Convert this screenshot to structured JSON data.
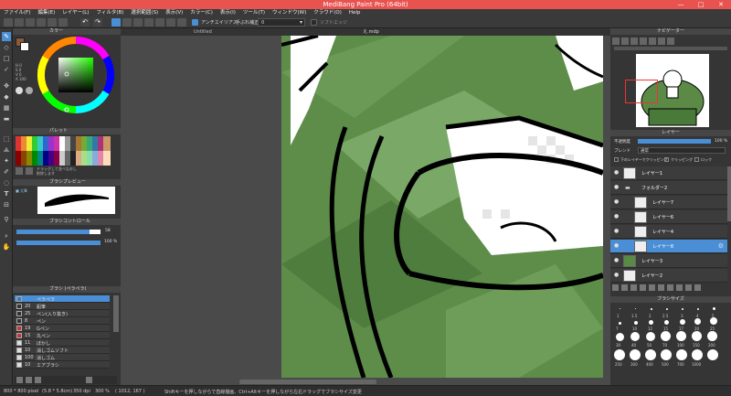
{
  "app": {
    "title": "MediBang Paint Pro (64bit)",
    "window_controls": [
      "—",
      "□",
      "✕"
    ]
  },
  "menu": [
    "ファイル(F)",
    "編集(E)",
    "レイヤー(L)",
    "フィルタ(B)",
    "選択範囲(S)",
    "表示(V)",
    "カラー(C)",
    "表示(I)",
    "ツール(T)",
    "ウィンドウ(W)",
    "クラウド(O)",
    "Help"
  ],
  "toolbar": {
    "antialias_label": "アンチエイリアス",
    "correction_label": "手ぶれ補正",
    "correction_value": "0",
    "soft_edge_label": "ソフトエッジ"
  },
  "canvas": {
    "tabs": [
      "Untitled",
      "え.mdp"
    ]
  },
  "colorpanel": {
    "title": "カラー",
    "hsv_values": [
      "H 0",
      "S 0",
      "V 0",
      "A 100"
    ]
  },
  "palette": {
    "title": "パレット",
    "note": "ドラッグして並べなおし\n削除します"
  },
  "brushpreview": {
    "title": "ブラシプレビュー",
    "label": "■ 太筆"
  },
  "brushcontrol": {
    "title": "ブラシコントロール",
    "size_value": "58",
    "opacity_value": "100 %"
  },
  "brushlist": {
    "title": "ブラシ (ペラペラ)",
    "items": [
      {
        "num": "",
        "name": "ペラペラ",
        "color": "#3a78c0"
      },
      {
        "num": "20",
        "name": "鉛筆",
        "color": "#333333"
      },
      {
        "num": "25",
        "name": "ペン(入り抜き)",
        "color": "#333333"
      },
      {
        "num": "8",
        "name": "ペン",
        "color": "#333333"
      },
      {
        "num": "19",
        "name": "Gペン",
        "color": "#cc3333"
      },
      {
        "num": "15",
        "name": "丸ペン",
        "color": "#cc3333"
      },
      {
        "num": "11",
        "name": "ぼかし",
        "color": "#dddddd"
      },
      {
        "num": "10",
        "name": "消しゴムソフト",
        "color": "#dddddd"
      },
      {
        "num": "100",
        "name": "消しゴム",
        "color": "#dddddd"
      },
      {
        "num": "10",
        "name": "エアブラシ",
        "color": "#dddddd"
      }
    ]
  },
  "navigator": {
    "title": "ナビゲーター"
  },
  "layers": {
    "title": "レイヤー",
    "opacity_label": "不透明度",
    "opacity_value": "100 %",
    "blend_label": "ブレンド",
    "blend_value": "通常",
    "checks": [
      "下のレイヤーでクリッピング",
      "クリッピング",
      "ロック"
    ],
    "items": [
      {
        "name": "レイヤー1",
        "indent": 0,
        "selected": false
      },
      {
        "name": "フォルダー2",
        "indent": 0,
        "selected": false
      },
      {
        "name": "レイヤー7",
        "indent": 1,
        "selected": false
      },
      {
        "name": "レイヤー6",
        "indent": 1,
        "selected": false
      },
      {
        "name": "レイヤー4",
        "indent": 1,
        "selected": false
      },
      {
        "name": "レイヤー8",
        "indent": 1,
        "selected": true
      },
      {
        "name": "レイヤー3",
        "indent": 0,
        "selected": false
      },
      {
        "name": "レイヤー2",
        "indent": 0,
        "selected": false
      }
    ]
  },
  "brushsize": {
    "title": "ブラシサイズ",
    "sizes": [
      "1",
      "1.5",
      "2",
      "2.5",
      "3",
      "4",
      "5",
      "7",
      "10",
      "12",
      "15",
      "17",
      "20",
      "25",
      "30",
      "40",
      "50",
      "70",
      "100",
      "150",
      "200",
      "250",
      "300",
      "400",
      "500",
      "700",
      "1000"
    ]
  },
  "status": {
    "size": "800 * 800 pixel",
    "mm": "(5.8 * 5.8cm)",
    "dpi": "350 dpi",
    "zoom": "300 %",
    "coords": "( 1012, 167 )",
    "hint": "Shiftキーを押しながらで直線描画、Ctrl+Altキーを押しながら左右ドラッグでブラシサイズ変更"
  }
}
